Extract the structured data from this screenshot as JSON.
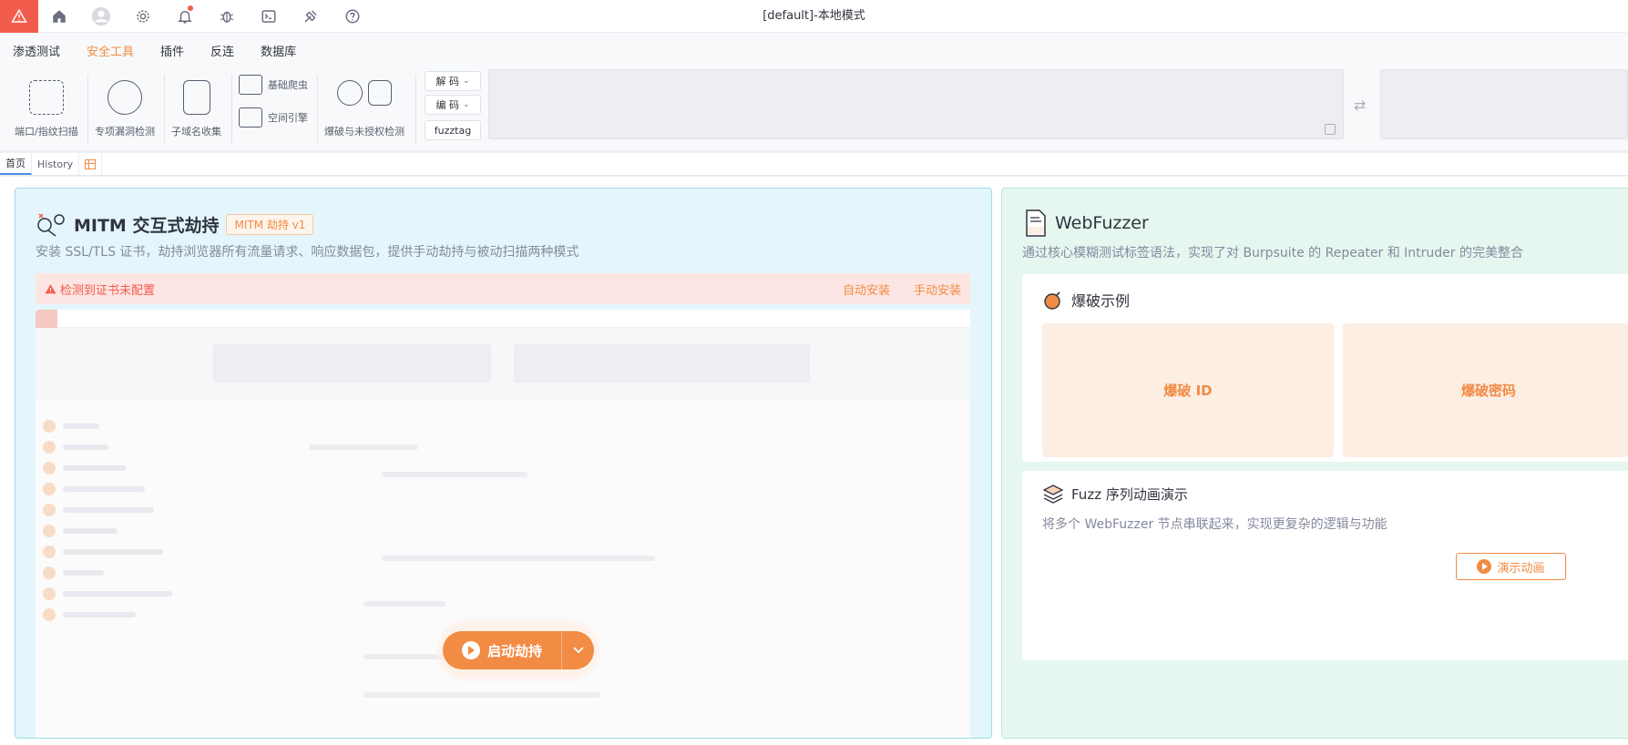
{
  "window": {
    "title": "[default]-本地模式"
  },
  "titlebar": {
    "icons": [
      "warning-icon",
      "home-icon",
      "user-avatar-icon",
      "gear-icon",
      "bell-icon",
      "bug-icon",
      "terminal-icon",
      "tools-icon",
      "help-icon"
    ]
  },
  "menu": {
    "items": [
      "渗透测试",
      "安全工具",
      "插件",
      "反连",
      "数据库"
    ],
    "active": "安全工具"
  },
  "ribbon": {
    "tools": {
      "port_scan": "端口/指纹扫描",
      "vuln_detect": "专项漏洞检测",
      "subdomain": "子域名收集",
      "crawler": "基础爬虫",
      "space_engine": "空间引擎",
      "brute": "爆破与未授权检测"
    },
    "codec": {
      "decode": "解 码",
      "encode": "编 码",
      "fuzztag": "fuzztag"
    }
  },
  "tabs": [
    "首页",
    "History"
  ],
  "mitm": {
    "title": "MITM 交互式劫持",
    "badge": "MITM 劫持 v1",
    "desc": "安装 SSL/TLS 证书，劫持浏览器所有流量请求、响应数据包，提供手动劫持与被动扫描两种模式",
    "cert_warning": "检测到证书未配置",
    "auto_install": "自动安装",
    "manual_install": "手动安装",
    "start_button": "启动劫持"
  },
  "webfuzzer": {
    "title": "WebFuzzer",
    "desc": "通过核心模糊测试标签语法，实现了对 Burpsuite 的 Repeater 和 Intruder 的完美整合",
    "brute_section": {
      "title": "爆破示例",
      "items": [
        "爆破 ID",
        "爆破密码"
      ]
    },
    "seq_section": {
      "title": "Fuzz 序列动画演示",
      "desc": "将多个 WebFuzzer 节点串联起来，实现更复杂的逻辑与功能",
      "button": "演示动画"
    }
  },
  "colors": {
    "accent": "#f28b44",
    "danger": "#f25c4d",
    "mitm_bg": "#e4f6fb",
    "webfuzzer_bg": "#e5f7ef"
  }
}
